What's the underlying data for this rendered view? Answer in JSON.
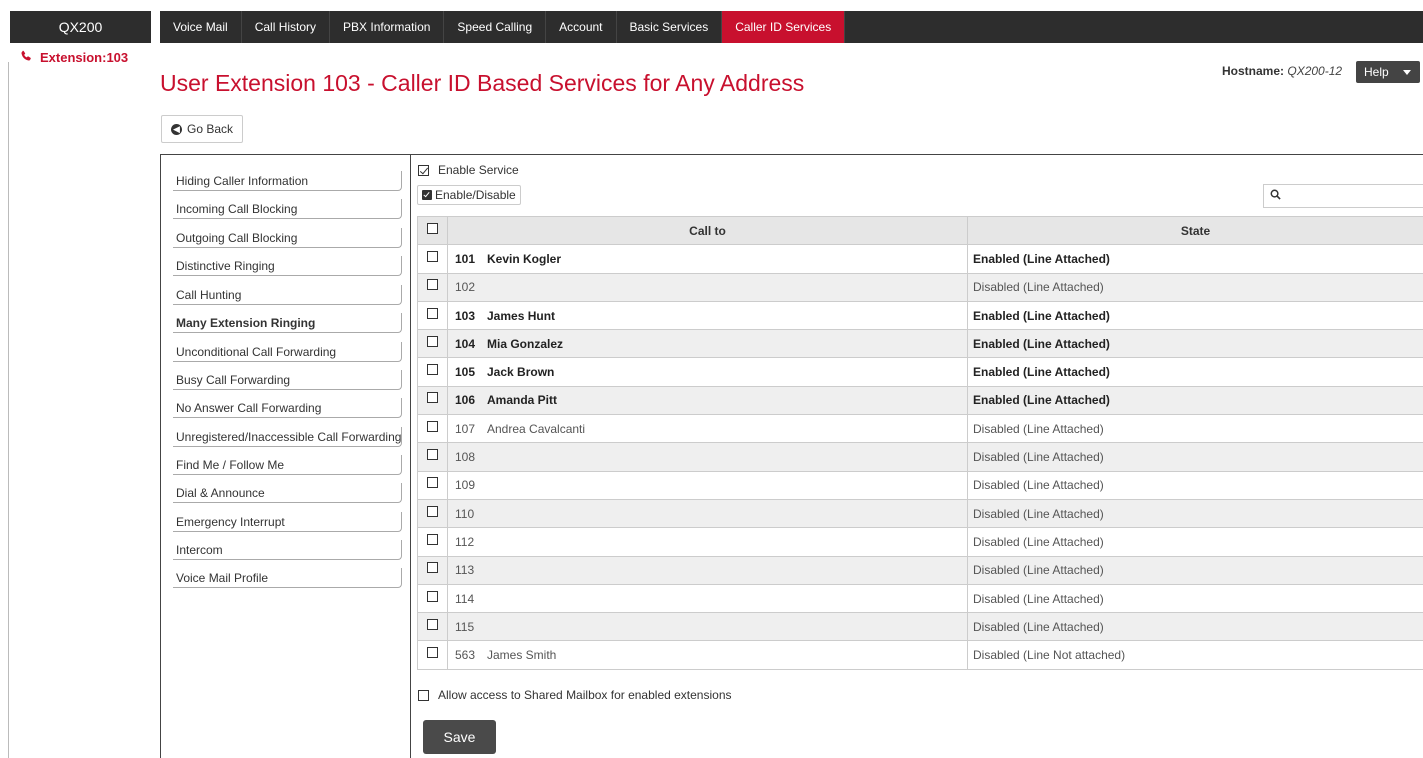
{
  "app": {
    "brand": "QX200"
  },
  "nav": {
    "tabs": [
      {
        "label": "Voice Mail"
      },
      {
        "label": "Call History"
      },
      {
        "label": "PBX Information"
      },
      {
        "label": "Speed Calling"
      },
      {
        "label": "Account"
      },
      {
        "label": "Basic Services"
      },
      {
        "label": "Caller ID Services",
        "active": true
      }
    ]
  },
  "extension": {
    "label": "Extension:103",
    "icon": "phone-icon"
  },
  "header": {
    "title": "User Extension 103 - Caller ID Based Services for Any Address",
    "hostname_label": "Hostname:",
    "hostname_value": "QX200-12",
    "help_label": "Help"
  },
  "go_back": {
    "label": "Go Back"
  },
  "menu": {
    "items": [
      {
        "label": "Hiding Caller Information"
      },
      {
        "label": "Incoming Call Blocking"
      },
      {
        "label": "Outgoing Call Blocking"
      },
      {
        "label": "Distinctive Ringing"
      },
      {
        "label": "Call Hunting"
      },
      {
        "label": "Many Extension Ringing",
        "current": true
      },
      {
        "label": "Unconditional Call Forwarding"
      },
      {
        "label": "Busy Call Forwarding"
      },
      {
        "label": "No Answer Call Forwarding"
      },
      {
        "label": "Unregistered/Inaccessible Call Forwarding"
      },
      {
        "label": "Find Me / Follow Me"
      },
      {
        "label": "Dial & Announce"
      },
      {
        "label": "Emergency Interrupt"
      },
      {
        "label": "Intercom"
      },
      {
        "label": "Voice Mail Profile"
      }
    ]
  },
  "service": {
    "enable_service_label": "Enable Service",
    "enable_service_checked": true,
    "enable_disable_label": "Enable/Disable",
    "search_placeholder": ""
  },
  "table": {
    "columns": [
      "Call to",
      "State"
    ],
    "rows": [
      {
        "ext": "101",
        "name": "Kevin Kogler",
        "state": "Enabled (Line Attached)",
        "enabled": true
      },
      {
        "ext": "102",
        "name": "",
        "state": "Disabled (Line Attached)",
        "enabled": false
      },
      {
        "ext": "103",
        "name": "James Hunt",
        "state": "Enabled (Line Attached)",
        "enabled": true
      },
      {
        "ext": "104",
        "name": "Mia Gonzalez",
        "state": "Enabled (Line Attached)",
        "enabled": true
      },
      {
        "ext": "105",
        "name": "Jack Brown",
        "state": "Enabled (Line Attached)",
        "enabled": true
      },
      {
        "ext": "106",
        "name": "Amanda Pitt",
        "state": "Enabled (Line Attached)",
        "enabled": true
      },
      {
        "ext": "107",
        "name": "Andrea Cavalcanti",
        "state": "Disabled (Line Attached)",
        "enabled": false
      },
      {
        "ext": "108",
        "name": "",
        "state": "Disabled (Line Attached)",
        "enabled": false
      },
      {
        "ext": "109",
        "name": "",
        "state": "Disabled (Line Attached)",
        "enabled": false
      },
      {
        "ext": "110",
        "name": "",
        "state": "Disabled (Line Attached)",
        "enabled": false
      },
      {
        "ext": "112",
        "name": "",
        "state": "Disabled (Line Attached)",
        "enabled": false
      },
      {
        "ext": "113",
        "name": "",
        "state": "Disabled (Line Attached)",
        "enabled": false
      },
      {
        "ext": "114",
        "name": "",
        "state": "Disabled (Line Attached)",
        "enabled": false
      },
      {
        "ext": "115",
        "name": "",
        "state": "Disabled (Line Attached)",
        "enabled": false
      },
      {
        "ext": "563",
        "name": "James Smith",
        "state": "Disabled (Line Not attached)",
        "enabled": false
      }
    ]
  },
  "footer": {
    "shared_mailbox_label": "Allow access to Shared Mailbox for enabled extensions",
    "shared_mailbox_checked": false,
    "save_label": "Save"
  },
  "colors": {
    "accent": "#c8102e",
    "navbar": "#2d2d2d",
    "button_dark": "#4a4a4a"
  }
}
